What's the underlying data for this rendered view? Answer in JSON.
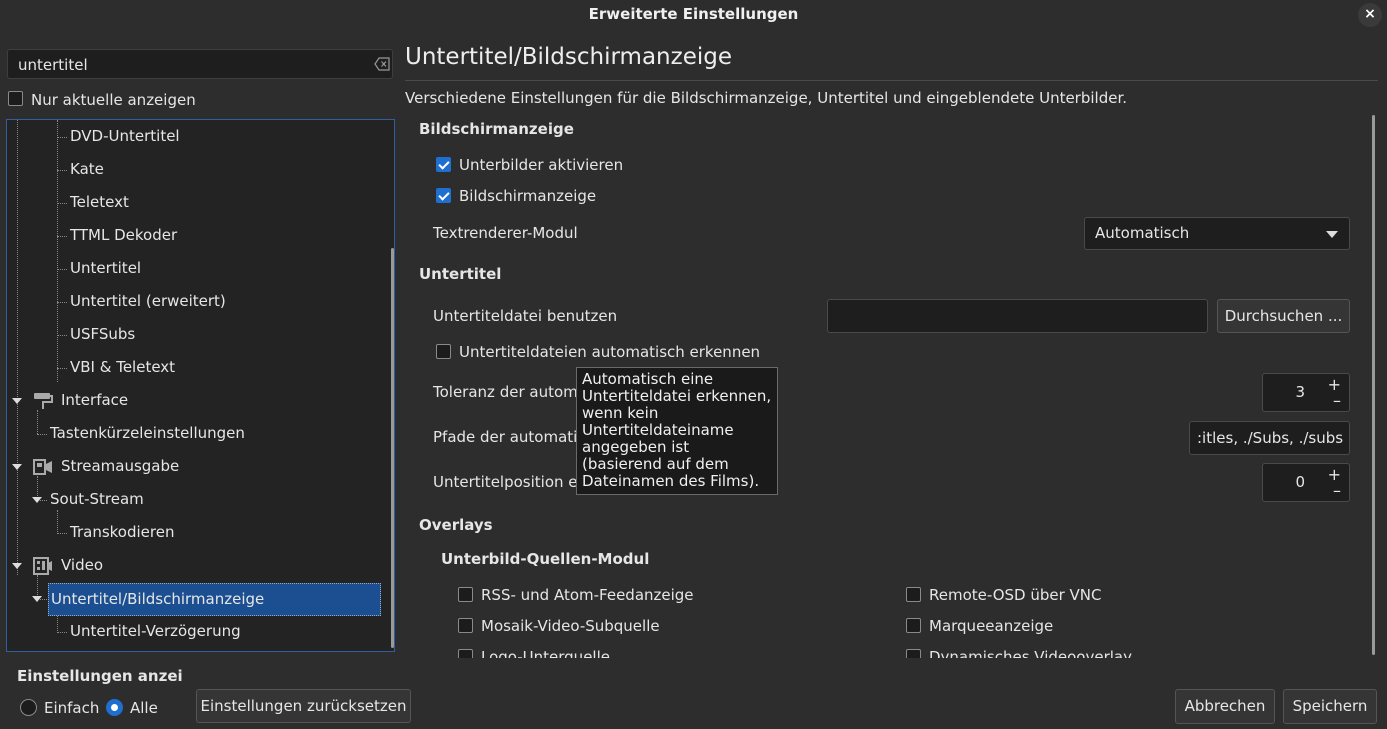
{
  "window": {
    "title": "Erweiterte Einstellungen",
    "close_label": "×"
  },
  "search": {
    "value": "untertitel"
  },
  "only_current": {
    "label": "Nur aktuelle anzeigen",
    "checked": false
  },
  "tree": {
    "items": [
      {
        "label": "DVD-Untertitel"
      },
      {
        "label": "Kate"
      },
      {
        "label": "Teletext"
      },
      {
        "label": "TTML Dekoder"
      },
      {
        "label": "Untertitel"
      },
      {
        "label": "Untertitel (erweitert)"
      },
      {
        "label": "USFSubs"
      },
      {
        "label": "VBI & Teletext"
      },
      {
        "label": "Interface"
      },
      {
        "label": "Tastenkürzeleinstellungen"
      },
      {
        "label": "Streamausgabe"
      },
      {
        "label": "Sout-Stream"
      },
      {
        "label": "Transkodieren"
      },
      {
        "label": "Video"
      },
      {
        "label": "Untertitel/Bildschirmanzeige"
      },
      {
        "label": "Untertitel-Verzögerung"
      }
    ]
  },
  "panel": {
    "title": "Untertitel/Bildschirmanzeige",
    "description": "Verschiedene Einstellungen für die Bildschirmanzeige, Untertitel und eingeblendete Unterbilder.",
    "osd": {
      "heading": "Bildschirmanzeige",
      "enable_subpictures": "Unterbilder aktivieren",
      "osd": "Bildschirmanzeige",
      "text_renderer_label": "Textrenderer-Modul",
      "text_renderer_value": "Automatisch"
    },
    "subtitles": {
      "heading": "Untertitel",
      "use_file_label": "Untertiteldatei benutzen",
      "browse": "Durchsuchen ...",
      "autodetect": "Untertiteldateien automatisch erkennen",
      "tolerance_label": "Toleranz der automa",
      "tolerance_value": "3",
      "paths_label": "Pfade der automatis",
      "paths_value": ":itles, ./Subs, ./subs",
      "position_label": "Untertitelposition erz",
      "position_value": "0",
      "plus": "+",
      "minus": "–"
    },
    "tooltip": "Automatisch eine Untertiteldatei erkennen, wenn kein Untertiteldateiname angegeben ist (basierend auf dem Dateinamen des Films).",
    "overlays": {
      "heading": "Overlays",
      "sub_heading": "Unterbild-Quellen-Modul",
      "items": [
        "RSS- und Atom-Feedanzeige",
        "Remote-OSD über VNC",
        "Mosaik-Video-Subquelle",
        "Marqueeanzeige",
        "Logo-Unterquelle",
        "Dynamisches Videooverlay"
      ]
    }
  },
  "bottom": {
    "heading": "Einstellungen anzeigen",
    "simple": "Einfach",
    "all": "Alle",
    "reset": "Einstellungen zurücksetzen",
    "cancel": "Abbrechen",
    "save": "Speichern"
  }
}
